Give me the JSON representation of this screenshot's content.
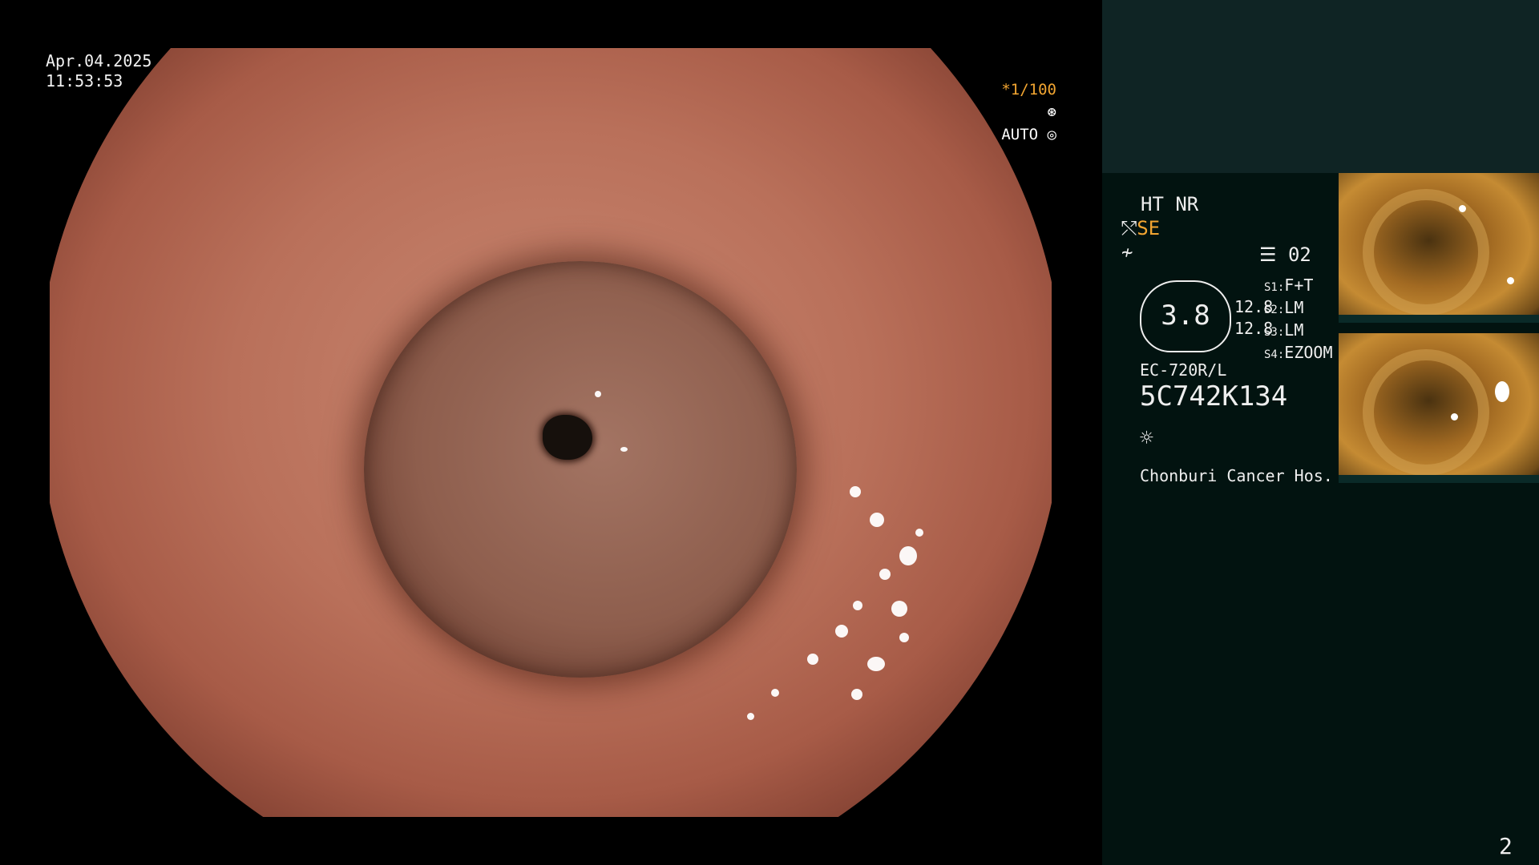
{
  "overlay": {
    "date": "Apr.04.2025",
    "time": "11:53:53",
    "shutter": "*1/100",
    "iris": "AUTO"
  },
  "side_panel": {
    "mode": "HT NR",
    "enhance": "SE",
    "memory_code": "02",
    "dial_value": "3.8",
    "dial_left_1": "12.8",
    "dial_left_2": "12.8",
    "presets": [
      {
        "key": "S1:",
        "value": "F+T"
      },
      {
        "key": "S2:",
        "value": "LM"
      },
      {
        "key": "S3:",
        "value": "LM"
      },
      {
        "key": "S4:",
        "value": "EZOOM"
      }
    ],
    "scope_model": "EC-720R/L",
    "scope_serial": "5C742K134",
    "hospital": "Chonburi Cancer Hos."
  },
  "page_number": "2",
  "icons": {
    "shutter_icon": "aperture-icon",
    "iris_icon": "iris-icon",
    "sun_icon": "sun-icon",
    "enhance_icon": "wave-icon",
    "memory_icon": "memory-card-icon"
  },
  "colors": {
    "accent": "#f2a531",
    "panel_bg": "#021310",
    "panel_top": "#0f2424"
  }
}
